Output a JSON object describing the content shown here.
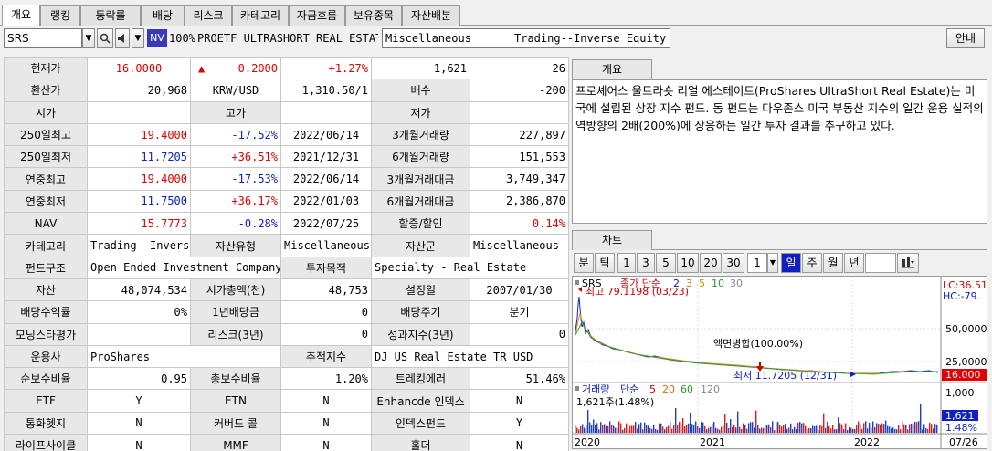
{
  "tabs": [
    "개요",
    "랭킹",
    "등락률",
    "배당",
    "리스크",
    "카테고리",
    "자금흐름",
    "보유종목",
    "자산배분"
  ],
  "toolbar": {
    "symbol": "SRS",
    "nv_badge": "NV",
    "zoom": "100%",
    "fund_name": "PROETF ULTRASHORT REAL ESTAT",
    "category": "Miscellaneous",
    "subcategory": "Trading--Inverse Equity",
    "guide_button": "안내"
  },
  "grid": {
    "r1": {
      "l1": "현재가",
      "price": "16.0000",
      "arrow": "▲",
      "change": "0.2000",
      "pct": "+1.27%",
      "vol": "1,621",
      "v2": "26"
    },
    "r2": {
      "l1": "환산가",
      "val": "20,968",
      "unit": "KRW/USD",
      "rate": "1,310.50/1",
      "l2": "배수",
      "mult": "-200"
    },
    "r3": {
      "l1": "시가",
      "l2": "고가",
      "l3": "저가"
    },
    "r4": {
      "l1": "250일최고",
      "v1": "19.4000",
      "v2": "-17.52%",
      "d": "2022/06/14",
      "l2": "3개월거래량",
      "v3": "227,897"
    },
    "r5": {
      "l1": "250일최저",
      "v1": "11.7205",
      "v2": "+36.51%",
      "d": "2021/12/31",
      "l2": "6개월거래량",
      "v3": "151,553"
    },
    "r6": {
      "l1": "연중최고",
      "v1": "19.4000",
      "v2": "-17.53%",
      "d": "2022/06/14",
      "l2": "3개월거래대금",
      "v3": "3,749,347"
    },
    "r7": {
      "l1": "연중최저",
      "v1": "11.7500",
      "v2": "+36.17%",
      "d": "2022/01/03",
      "l2": "6개월거래대금",
      "v3": "2,386,870"
    },
    "r8": {
      "l1": "NAV",
      "v1": "15.7773",
      "v2": "-0.28%",
      "d": "2022/07/25",
      "l2": "할증/할인",
      "v3": "0.14%"
    },
    "r9": {
      "l1": "카테고리",
      "v1": "Trading--Invers",
      "l2": "자산유형",
      "v2": "Miscellaneous",
      "l3": "자산군",
      "v3": "Miscellaneous"
    },
    "r10": {
      "l1": "펀드구조",
      "v1": "Open Ended Investment Company",
      "l2": "투자목적",
      "v2": "Specialty - Real Estate"
    },
    "r11": {
      "l1": "자산",
      "v1": "48,074,534",
      "l2": "시가총액(천)",
      "v2": "48,753",
      "l3": "설정일",
      "v3": "2007/01/30"
    },
    "r12": {
      "l1": "배당수익률",
      "v1": "0%",
      "l2": "1년배당금",
      "v2": "0",
      "l3": "배당주기",
      "v3": "분기"
    },
    "r13": {
      "l1": "모닝스타평가",
      "v1": "",
      "l2": "리스크(3년)",
      "v2": "0",
      "l3": "성과지수(3년)",
      "v3": "0"
    },
    "r14": {
      "l1": "운용사",
      "v1": "ProShares",
      "l2": "추적지수",
      "v2": "DJ US Real Estate TR USD"
    },
    "r15": {
      "l1": "순보수비율",
      "v1": "0.95",
      "l2": "총보수비율",
      "v2": "1.20%",
      "l3": "트레킹에러",
      "v3": "51.46%"
    },
    "r16": {
      "l1": "ETF",
      "v1": "Y",
      "l2": "ETN",
      "v2": "N",
      "l3": "Enhancde 인덱스",
      "v3": "N"
    },
    "r17": {
      "l1": "통화헷지",
      "v1": "N",
      "l2": "커버드 콜",
      "v2": "N",
      "l3": "인덱스펀드",
      "v3": "Y"
    },
    "r18": {
      "l1": "라이프사이클",
      "v1": "N",
      "l2": "MMF",
      "v2": "N",
      "l3": "홀더",
      "v3": "N"
    }
  },
  "overview": {
    "tab": "개요",
    "text": "프로셰어스 울트라숏 리얼 에스테이트(ProShares UltraShort Real Estate)는 미국에 설립된 상장 지수 펀드. 동 펀드는 다우존스 미국 부동산 지수의 일간 운용 실적의 역방향의 2배(200%)에 상응하는 일간 투자 결과를 추구하고 있다."
  },
  "chart": {
    "tab": "차트",
    "buttons": [
      "분",
      "틱",
      "1",
      "3",
      "5",
      "10",
      "20",
      "30",
      "1",
      "일",
      "주",
      "월",
      "년"
    ],
    "active_button": "일",
    "price_legend": {
      "name": "SRS",
      "ma": "종가 단순",
      "p1": "2",
      "p2": "3",
      "p3": "5",
      "p4": "10",
      "p5": "30"
    },
    "high_note": "최고 79.1198 (03/23)",
    "split_note": "액면병합(100.00%)",
    "low_note": "최저 11.7205 (12/31)",
    "lc": "LC:36.51",
    "hc": "HC:-79.",
    "y_50000": "50,0000",
    "y_25000": "25,0000",
    "last_price": "16.000",
    "vol_legend": {
      "name": "거래량",
      "ma": "단순",
      "p1": "5",
      "p2": "20",
      "p3": "60",
      "p4": "120"
    },
    "vol_note": "1,621주(1.48%)",
    "vol_axis": "1,000",
    "vol_last": "1,621",
    "vol_pct": "1.48%",
    "x_labels": [
      "2020",
      "2021",
      "2022",
      "07/26"
    ]
  }
}
